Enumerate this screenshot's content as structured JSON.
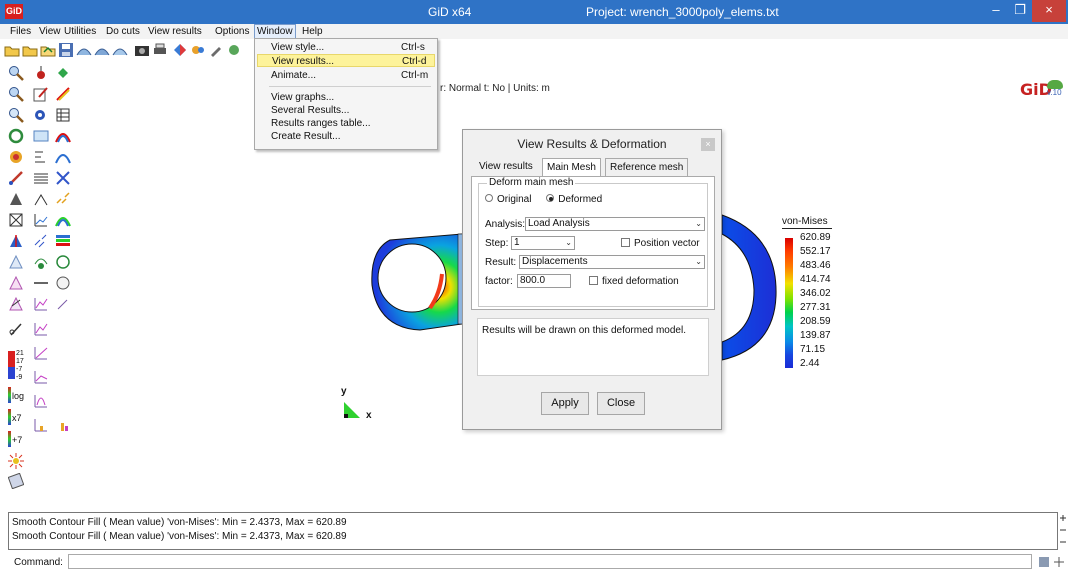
{
  "window": {
    "app_title": "GiD x64",
    "project_title": "Project: wrench_3000poly_elems.txt",
    "logo": "GiD",
    "minimize_label": "–",
    "maximize_label": "❐",
    "close_label": "×"
  },
  "menubar": {
    "items": [
      {
        "label": "Files"
      },
      {
        "label": "View"
      },
      {
        "label": "Utilities"
      },
      {
        "label": "Do cuts"
      },
      {
        "label": "View results"
      },
      {
        "label": "Options"
      },
      {
        "label": "Window"
      },
      {
        "label": "Help"
      }
    ],
    "active": "Window"
  },
  "toolbar": {
    "status_text": "r: Normal  t: No  |  Units: m",
    "brand": "GiD",
    "brand_version": "v.10"
  },
  "window_menu": {
    "items": [
      {
        "label": "View style...",
        "shortcut": "Ctrl-s"
      },
      {
        "label": "View results...",
        "shortcut": "Ctrl-d",
        "highlighted": true
      },
      {
        "label": "Animate...",
        "shortcut": "Ctrl-m"
      },
      {
        "label": "View graphs...",
        "shortcut": ""
      },
      {
        "label": "Several Results...",
        "shortcut": ""
      },
      {
        "label": "Results ranges table...",
        "shortcut": ""
      },
      {
        "label": "Create Result...",
        "shortcut": ""
      }
    ]
  },
  "legend": {
    "title": "von-Mises",
    "values": [
      "620.89",
      "552.17",
      "483.46",
      "414.74",
      "346.02",
      "277.31",
      "208.59",
      "139.87",
      "71.15",
      "2.44"
    ]
  },
  "triad": {
    "y_label": "y",
    "x_label": "x"
  },
  "dialog": {
    "title": "View Results & Deformation",
    "close_label": "×",
    "tabs": [
      {
        "label": "View results"
      },
      {
        "label": "Main Mesh",
        "active": true
      },
      {
        "label": "Reference mesh"
      }
    ],
    "group_label": "Deform main mesh",
    "radio_original": "Original",
    "radio_deformed": "Deformed",
    "deform_selected": "Deformed",
    "analysis_label": "Analysis:",
    "analysis_value": "Load Analysis",
    "step_label": "Step:",
    "step_value": "1",
    "position_vector_label": "Position vector",
    "position_vector_checked": false,
    "result_label": "Result:",
    "result_value": "Displacements",
    "factor_label": "factor:",
    "factor_value": "800.0",
    "fixed_deformation_label": "fixed deformation",
    "fixed_deformation_checked": false,
    "info_text": "Results will be drawn on this deformed model.",
    "apply_label": "Apply",
    "close_button_label": "Close"
  },
  "output": {
    "lines": [
      "Smooth Contour Fill ( Mean value) 'von-Mises': Min = 2.4373, Max = 620.89",
      "Smooth Contour Fill ( Mean value) 'von-Mises': Min = 2.4373, Max = 620.89"
    ]
  },
  "command": {
    "label": "Command:",
    "value": ""
  },
  "palette_labels": {
    "legend_21": "21",
    "legend_17": "17",
    "legend_7": "-7",
    "legend_9": "-9",
    "log": "log",
    "x7": "x7",
    "plus7": "+7"
  },
  "colors": {
    "titlebar": "#2f73c6",
    "menu_highlight": "#fdf39b",
    "close_button": "#c7413a"
  }
}
